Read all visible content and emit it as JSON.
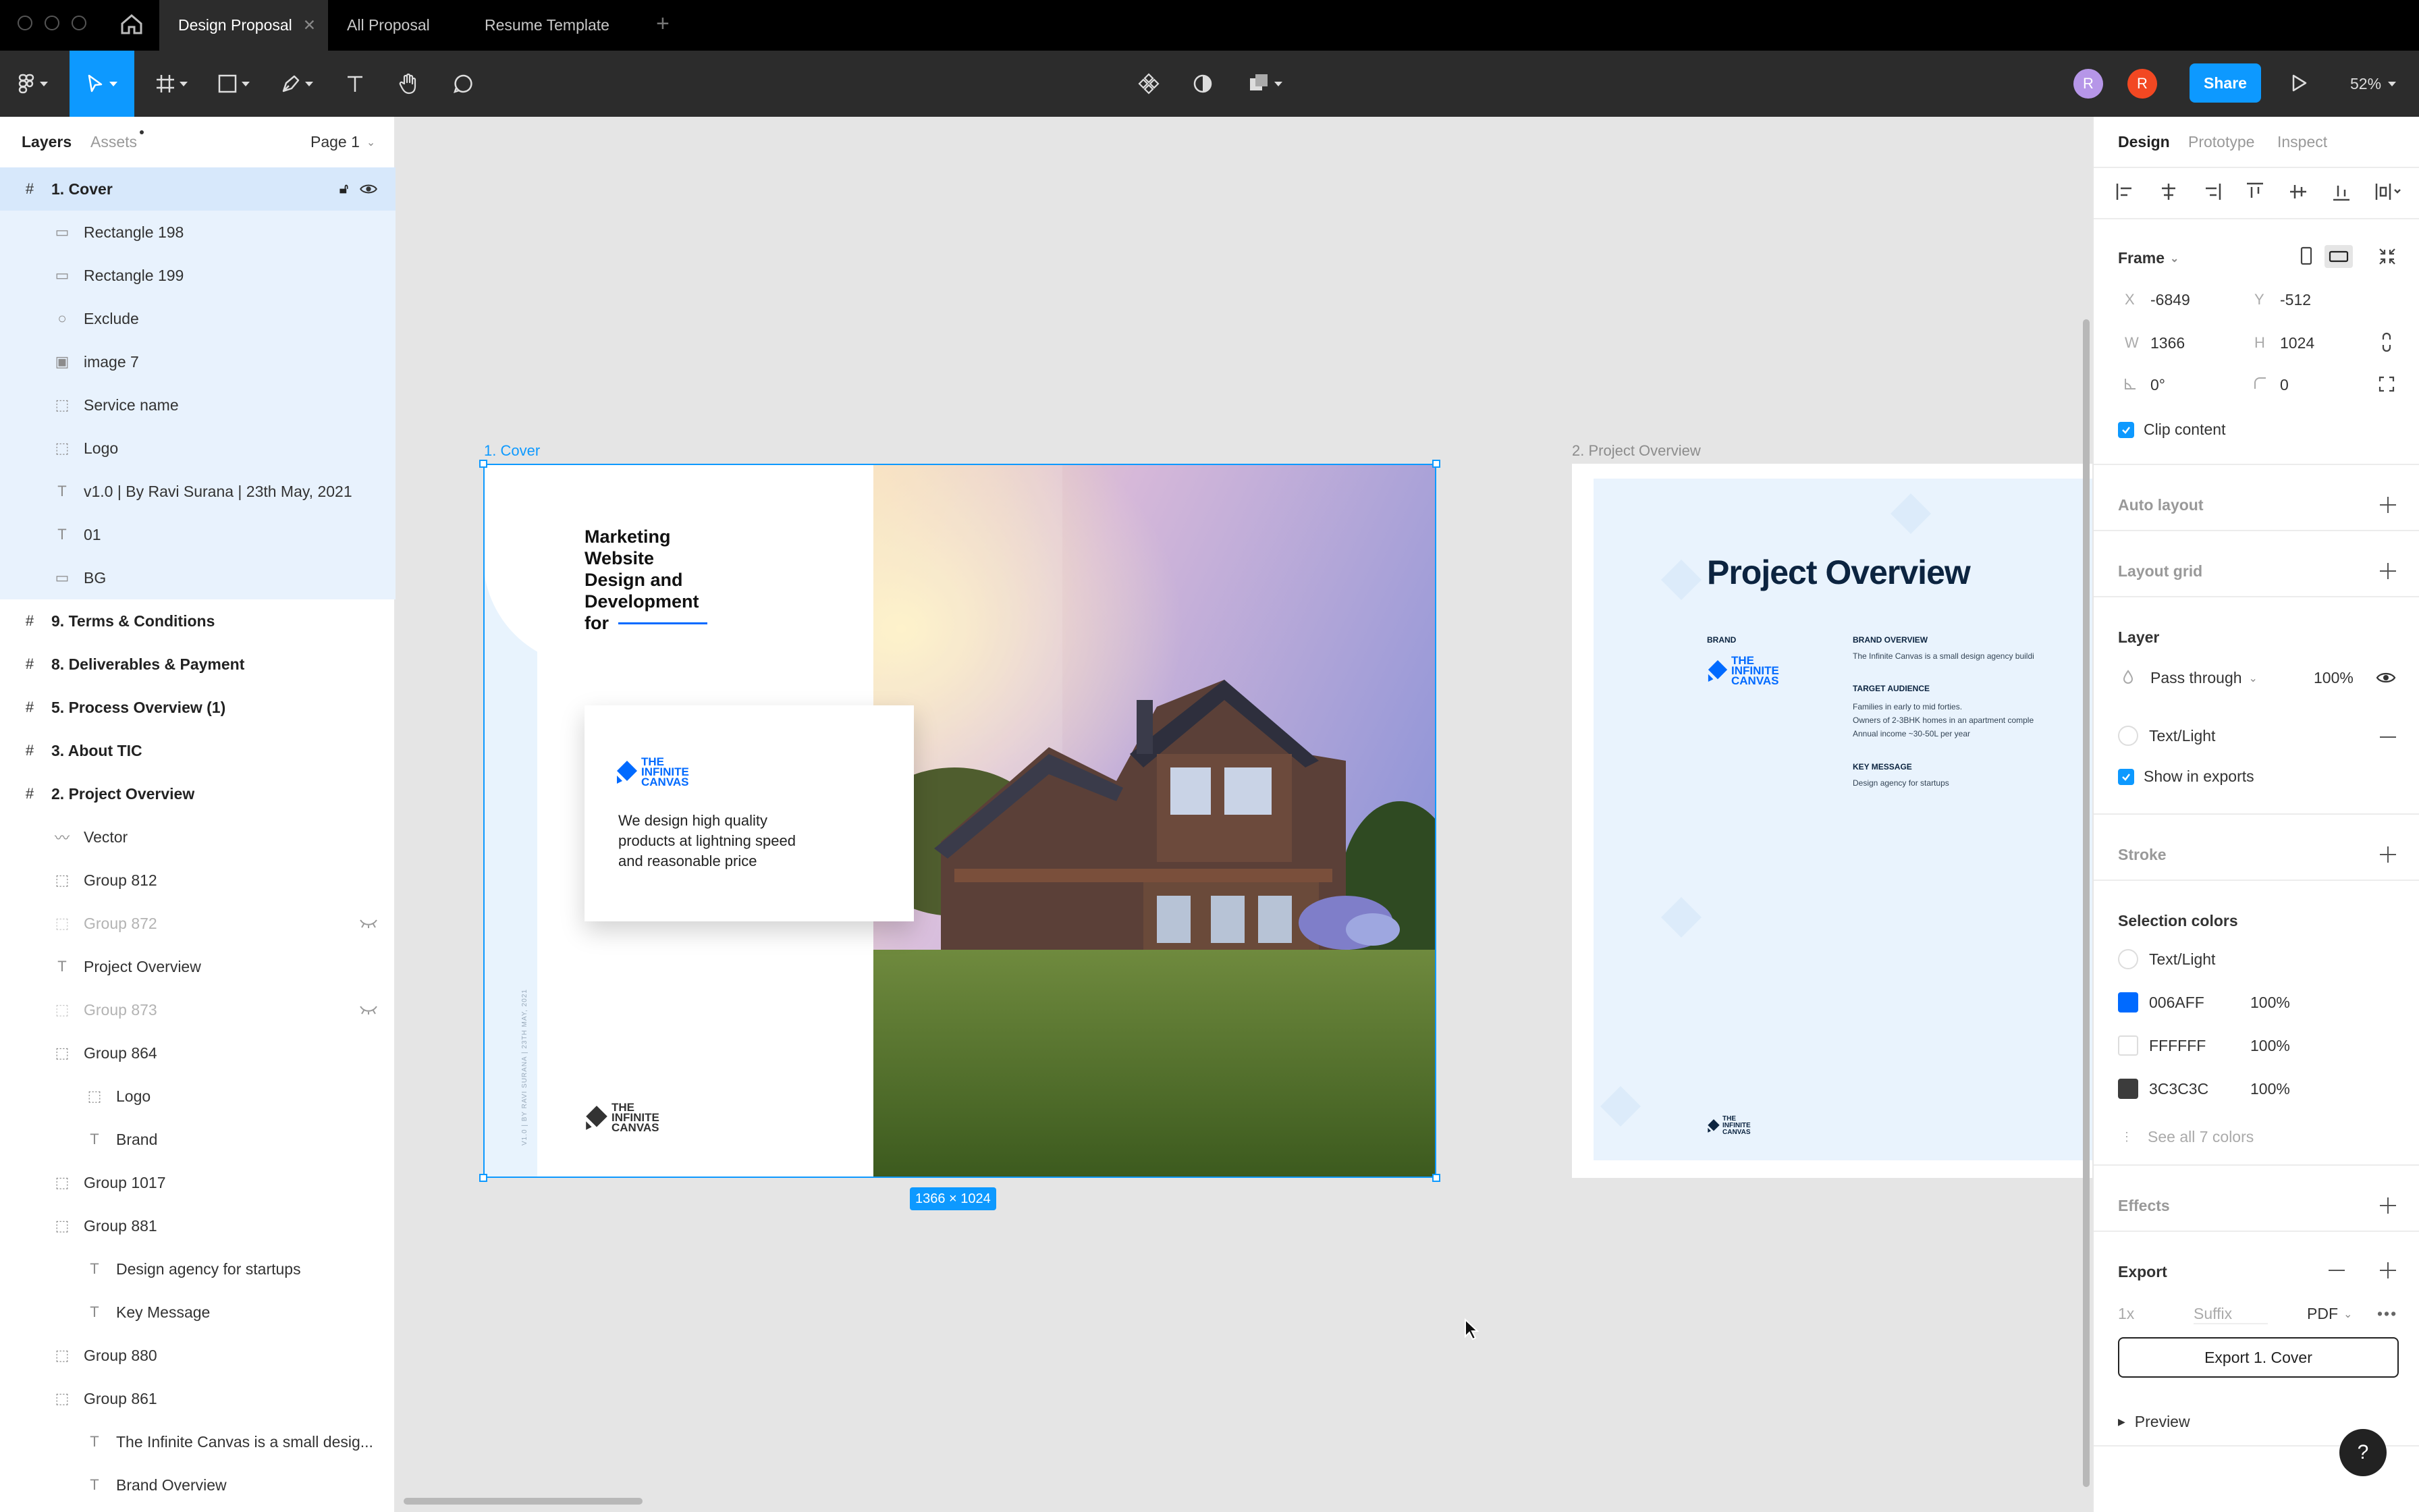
{
  "titlebar": {
    "tabs": [
      {
        "label": "Design Proposal",
        "active": true
      },
      {
        "label": "All Proposal",
        "active": false
      },
      {
        "label": "Resume Template",
        "active": false
      }
    ]
  },
  "toolbar": {
    "avatars": [
      "R",
      "R"
    ],
    "share_label": "Share",
    "zoom": "52%"
  },
  "left_panel": {
    "tab_layers": "Layers",
    "tab_assets": "Assets",
    "page_selector": "Page 1",
    "layers": [
      {
        "label": "1. Cover",
        "type": "frame",
        "indent": 0,
        "state": "top-sel"
      },
      {
        "label": "Rectangle 198",
        "type": "rect",
        "indent": 1,
        "state": "sel"
      },
      {
        "label": "Rectangle 199",
        "type": "rect",
        "indent": 1,
        "state": "sel"
      },
      {
        "label": "Exclude",
        "type": "circle",
        "indent": 1,
        "state": "sel"
      },
      {
        "label": "image 7",
        "type": "image",
        "indent": 1,
        "state": "sel"
      },
      {
        "label": "Service name",
        "type": "group",
        "indent": 1,
        "state": "sel"
      },
      {
        "label": "Logo",
        "type": "group",
        "indent": 1,
        "state": "sel"
      },
      {
        "label": "v1.0 | By Ravi Surana | 23th May, 2021",
        "type": "text",
        "indent": 1,
        "state": "sel"
      },
      {
        "label": "01",
        "type": "text",
        "indent": 1,
        "state": "sel"
      },
      {
        "label": "BG",
        "type": "rect",
        "indent": 1,
        "state": "sel"
      },
      {
        "label": "9. Terms & Conditions",
        "type": "frame",
        "indent": 0,
        "state": ""
      },
      {
        "label": "8. Deliverables & Payment",
        "type": "frame",
        "indent": 0,
        "state": ""
      },
      {
        "label": "5. Process Overview (1)",
        "type": "frame",
        "indent": 0,
        "state": ""
      },
      {
        "label": "3. About TIC",
        "type": "frame",
        "indent": 0,
        "state": ""
      },
      {
        "label": "2. Project Overview",
        "type": "frame",
        "indent": 0,
        "state": ""
      },
      {
        "label": "Vector",
        "type": "vector",
        "indent": 1,
        "state": ""
      },
      {
        "label": "Group 812",
        "type": "group",
        "indent": 1,
        "state": ""
      },
      {
        "label": "Group 872",
        "type": "group",
        "indent": 1,
        "state": "dim"
      },
      {
        "label": "Project Overview",
        "type": "text",
        "indent": 1,
        "state": ""
      },
      {
        "label": "Group 873",
        "type": "group",
        "indent": 1,
        "state": "dim"
      },
      {
        "label": "Group 864",
        "type": "group",
        "indent": 1,
        "state": ""
      },
      {
        "label": "Logo",
        "type": "group",
        "indent": 2,
        "state": ""
      },
      {
        "label": "Brand",
        "type": "text",
        "indent": 2,
        "state": ""
      },
      {
        "label": "Group 1017",
        "type": "group",
        "indent": 1,
        "state": ""
      },
      {
        "label": "Group 881",
        "type": "group",
        "indent": 1,
        "state": ""
      },
      {
        "label": "Design agency for startups",
        "type": "text",
        "indent": 2,
        "state": ""
      },
      {
        "label": "Key Message",
        "type": "text",
        "indent": 2,
        "state": ""
      },
      {
        "label": "Group 880",
        "type": "group",
        "indent": 1,
        "state": ""
      },
      {
        "label": "Group 861",
        "type": "group",
        "indent": 1,
        "state": ""
      },
      {
        "label": "The Infinite Canvas is a small desig...",
        "type": "text",
        "indent": 2,
        "state": ""
      },
      {
        "label": "Brand Overview",
        "type": "text",
        "indent": 2,
        "state": ""
      }
    ]
  },
  "canvas": {
    "frame1_label": "1. Cover",
    "frame2_label": "2. Project Overview",
    "size_badge": "1366 × 1024",
    "cover": {
      "headline_1": "Marketing",
      "headline_2": "Website",
      "headline_3": "Design and",
      "headline_4": "Development",
      "headline_5": "for",
      "logo_line1": "THE",
      "logo_line2": "INFINITE",
      "logo_line3": "CANVAS",
      "tagline_1": "We design high quality",
      "tagline_2": "products at lightning speed",
      "tagline_3": "and reasonable price",
      "vertical_text": "V1.0 | BY RAVI SURANA | 23TH MAY, 2021"
    },
    "overview": {
      "title": "Project Overview",
      "brand_label": "BRAND",
      "brand_overview_label": "BRAND OVERVIEW",
      "brand_overview_text": "The Infinite Canvas is a small design agency buildi",
      "target_label": "TARGET AUDIENCE",
      "target_1": "Families in early to mid forties.",
      "target_2": "Owners of 2-3BHK homes in an apartment comple",
      "target_3": "Annual income ~30-50L per year",
      "key_label": "KEY MESSAGE",
      "key_text": "Design agency for startups",
      "logo_line1": "THE",
      "logo_line2": "INFINITE",
      "logo_line3": "CANVAS"
    }
  },
  "right_panel": {
    "tabs": [
      "Design",
      "Prototype",
      "Inspect"
    ],
    "frame_label": "Frame",
    "x_label": "X",
    "x_value": "-6849",
    "y_label": "Y",
    "y_value": "-512",
    "w_label": "W",
    "w_value": "1366",
    "h_label": "H",
    "h_value": "1024",
    "rotation": "0°",
    "radius": "0",
    "clip_content": "Clip content",
    "auto_layout": "Auto layout",
    "layout_grid": "Layout grid",
    "layer_title": "Layer",
    "blend_mode": "Pass through",
    "opacity": "100%",
    "text_light": "Text/Light",
    "show_in_exports": "Show in exports",
    "stroke": "Stroke",
    "selection_colors": "Selection colors",
    "colors": [
      {
        "name": "Text/Light",
        "hex": "",
        "pct": "",
        "swatch": "#ffffff",
        "round": true
      },
      {
        "name": "006AFF",
        "hex": "#006AFF",
        "pct": "100%",
        "swatch": "#006aff",
        "round": false
      },
      {
        "name": "FFFFFF",
        "hex": "#FFFFFF",
        "pct": "100%",
        "swatch": "#ffffff",
        "round": false
      },
      {
        "name": "3C3C3C",
        "hex": "#3C3C3C",
        "pct": "100%",
        "swatch": "#3c3c3c",
        "round": false
      }
    ],
    "see_all": "See all 7 colors",
    "effects": "Effects",
    "export_title": "Export",
    "export_scale": "1x",
    "export_suffix": "Suffix",
    "export_format": "PDF",
    "export_button": "Export 1. Cover",
    "preview": "Preview",
    "help": "?"
  },
  "colors": {
    "accent": "#0d99ff",
    "brand_blue": "#006AFF",
    "toolbar_bg": "#2c2c2c",
    "share_bg": "#0d99ff"
  }
}
